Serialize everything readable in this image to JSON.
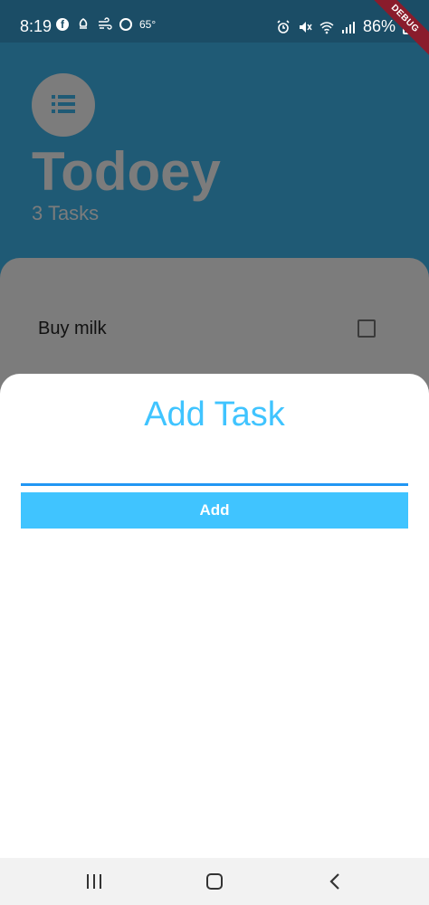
{
  "status_bar": {
    "time": "8:19",
    "temperature": "65°",
    "battery": "86%",
    "icons_left": [
      "facebook-icon",
      "notification-icon",
      "wind-icon",
      "app-icon"
    ],
    "icons_right": [
      "alarm-icon",
      "mute-icon",
      "wifi-icon",
      "signal-icon",
      "battery-icon"
    ]
  },
  "debug_banner": "DEBUG",
  "header": {
    "menu_icon": "list-icon",
    "title": "Todoey",
    "task_count": "3 Tasks"
  },
  "tasks": [
    {
      "title": "Buy milk",
      "done": false
    }
  ],
  "add_task_sheet": {
    "title": "Add Task",
    "input_value": "",
    "button_label": "Add"
  },
  "nav_bar": {
    "buttons": [
      "recents-icon",
      "home-icon",
      "back-icon"
    ]
  },
  "colors": {
    "header_bg": "#1f5a75",
    "overlay_grey": "#7c7c7c",
    "accent": "#40c4ff",
    "input_underline": "#2196f3",
    "debug_ribbon": "#8a1c2c"
  }
}
